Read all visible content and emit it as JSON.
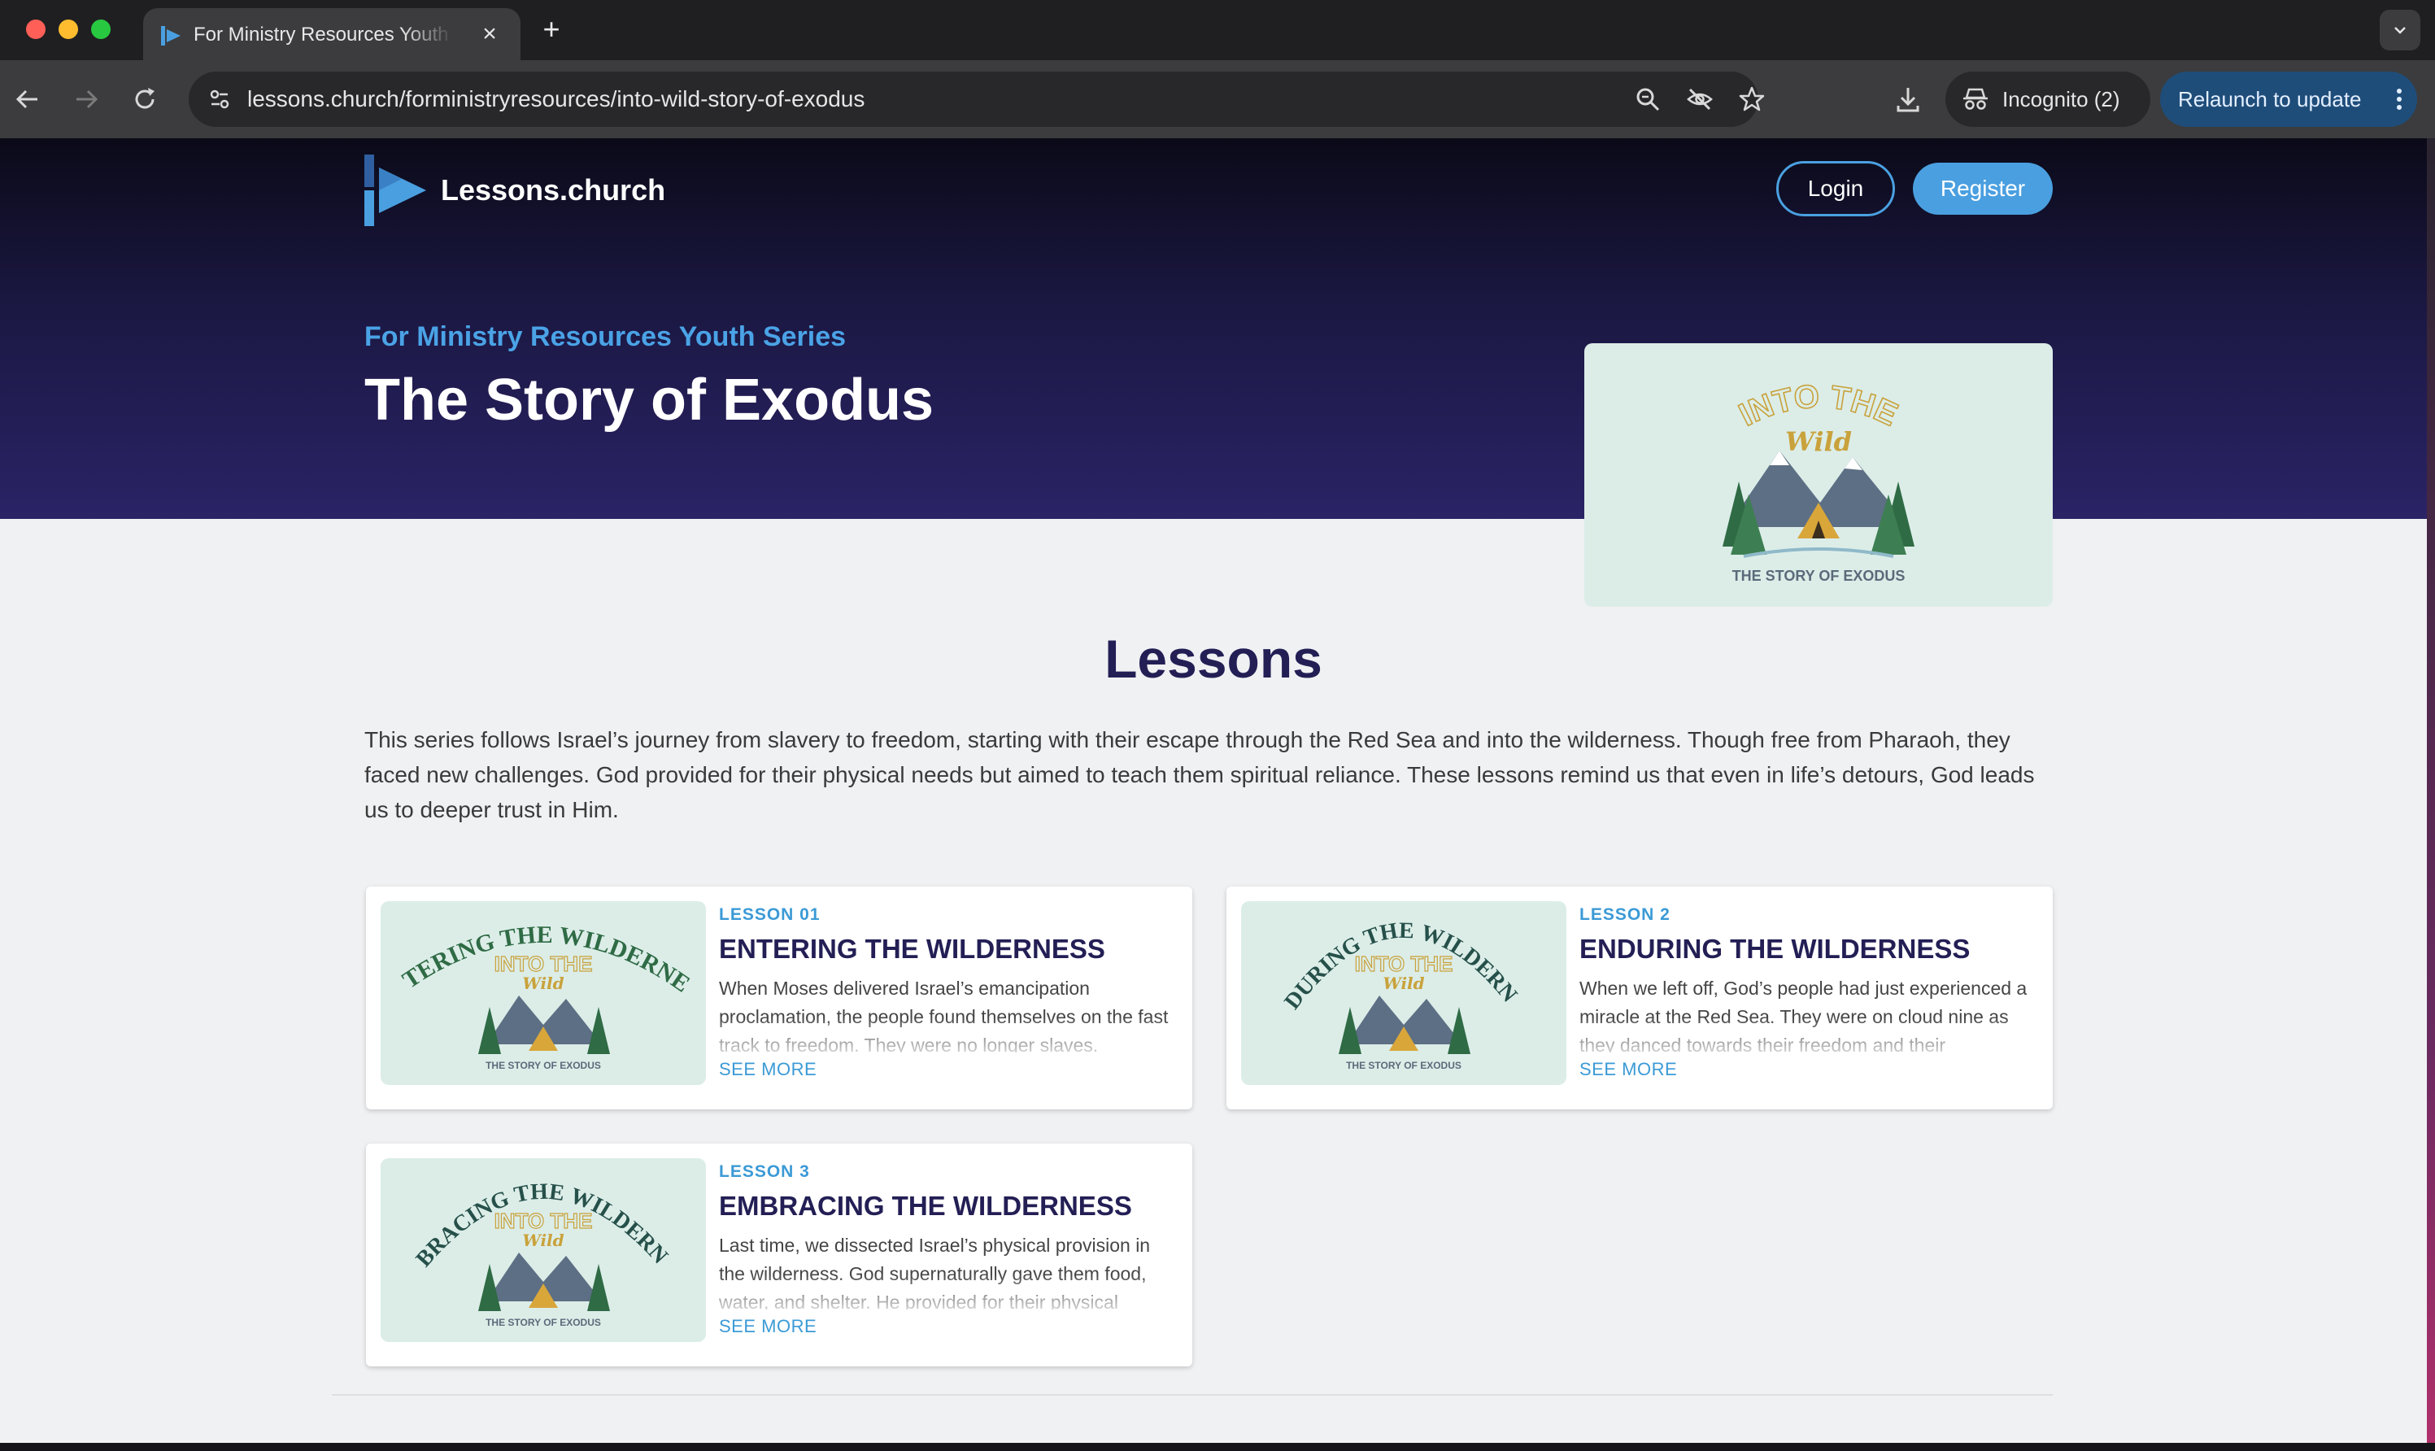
{
  "browser": {
    "tab_title": "For Ministry Resources Youth Series",
    "url": "lessons.church/forministryresources/into-wild-story-of-exodus",
    "incognito_label": "Incognito (2)",
    "relaunch_label": "Relaunch to update"
  },
  "header": {
    "logo_text": "Lessons.church",
    "login_label": "Login",
    "register_label": "Register"
  },
  "hero": {
    "series_label": "For Ministry Resources Youth Series",
    "title": "The Story of Exodus",
    "image_line1": "INTO THE",
    "image_line2": "Wild",
    "image_caption": "THE STORY OF EXODUS"
  },
  "lessons": {
    "heading": "Lessons",
    "description": "This series follows Israel’s journey from slavery to freedom, starting with their escape through the Red Sea and into the wilderness. Though free from Pharaoh, they faced new challenges. God provided for their physical needs but aimed to teach them spiritual reliance. These lessons remind us that even in life’s detours, God leads us to deeper trust in Him.",
    "items": [
      {
        "kicker": "LESSON 01",
        "title": "ENTERING THE WILDERNESS",
        "description": "When Moses delivered Israel’s emancipation proclamation, the people found themselves on the fast track to freedom. They were no longer slaves.",
        "more": "SEE MORE",
        "art_arc": "ENTERING THE WILDERNESS"
      },
      {
        "kicker": "LESSON 2",
        "title": "ENDURING THE WILDERNESS",
        "description": "When we left off, God’s people had just experienced a miracle at the Red Sea. They were on cloud nine as they danced towards their freedom and their",
        "more": "SEE MORE",
        "art_arc": "ENDURING THE WILDERNESS"
      },
      {
        "kicker": "LESSON 3",
        "title": "EMBRACING THE WILDERNESS",
        "description": "Last time, we dissected Israel’s physical provision in the wilderness. God supernaturally gave them food, water, and shelter. He provided for their physical",
        "more": "SEE MORE",
        "art_arc": "EMBRACING THE WILDERNESS"
      }
    ]
  },
  "colors": {
    "brand_blue": "#4a9fe0",
    "heading_navy": "#231f55",
    "hero_dark": "#1b1843",
    "art_green": "#2f6b45",
    "art_gold": "#c9a23c"
  }
}
